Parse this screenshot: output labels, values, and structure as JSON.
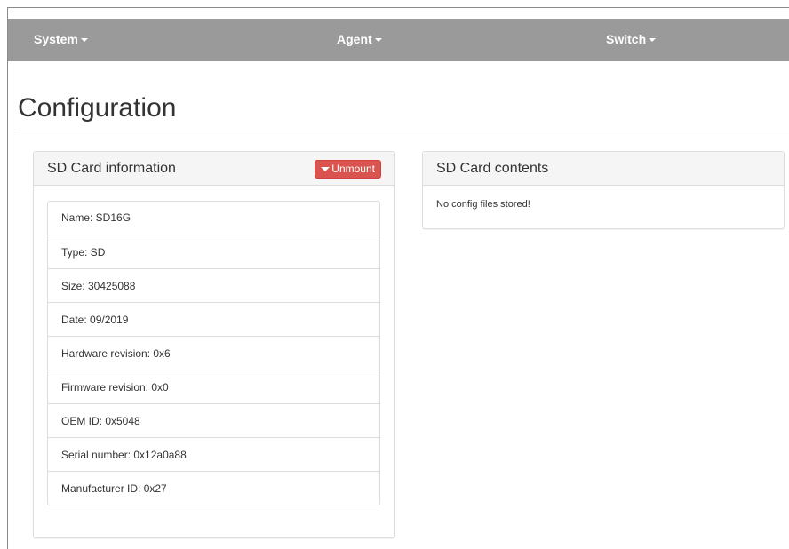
{
  "navbar": {
    "items": [
      {
        "label": "System"
      },
      {
        "label": "Agent"
      },
      {
        "label": "Switch"
      }
    ]
  },
  "page": {
    "title": "Configuration"
  },
  "sd_info": {
    "title": "SD Card information",
    "unmount_label": "Unmount",
    "unmount_color": "#d9534f",
    "items": [
      "Name: SD16G",
      "Type: SD",
      "Size: 30425088",
      "Date: 09/2019",
      "Hardware revision: 0x6",
      "Firmware revision: 0x0",
      "OEM ID: 0x5048",
      "Serial number: 0x12a0a88",
      "Manufacturer ID: 0x27"
    ]
  },
  "sd_contents": {
    "title": "SD Card contents",
    "empty_message": "No config files stored!"
  },
  "icons": {
    "nav_caret": "caret-down-icon",
    "unmount_caret": "caret-down-icon"
  }
}
